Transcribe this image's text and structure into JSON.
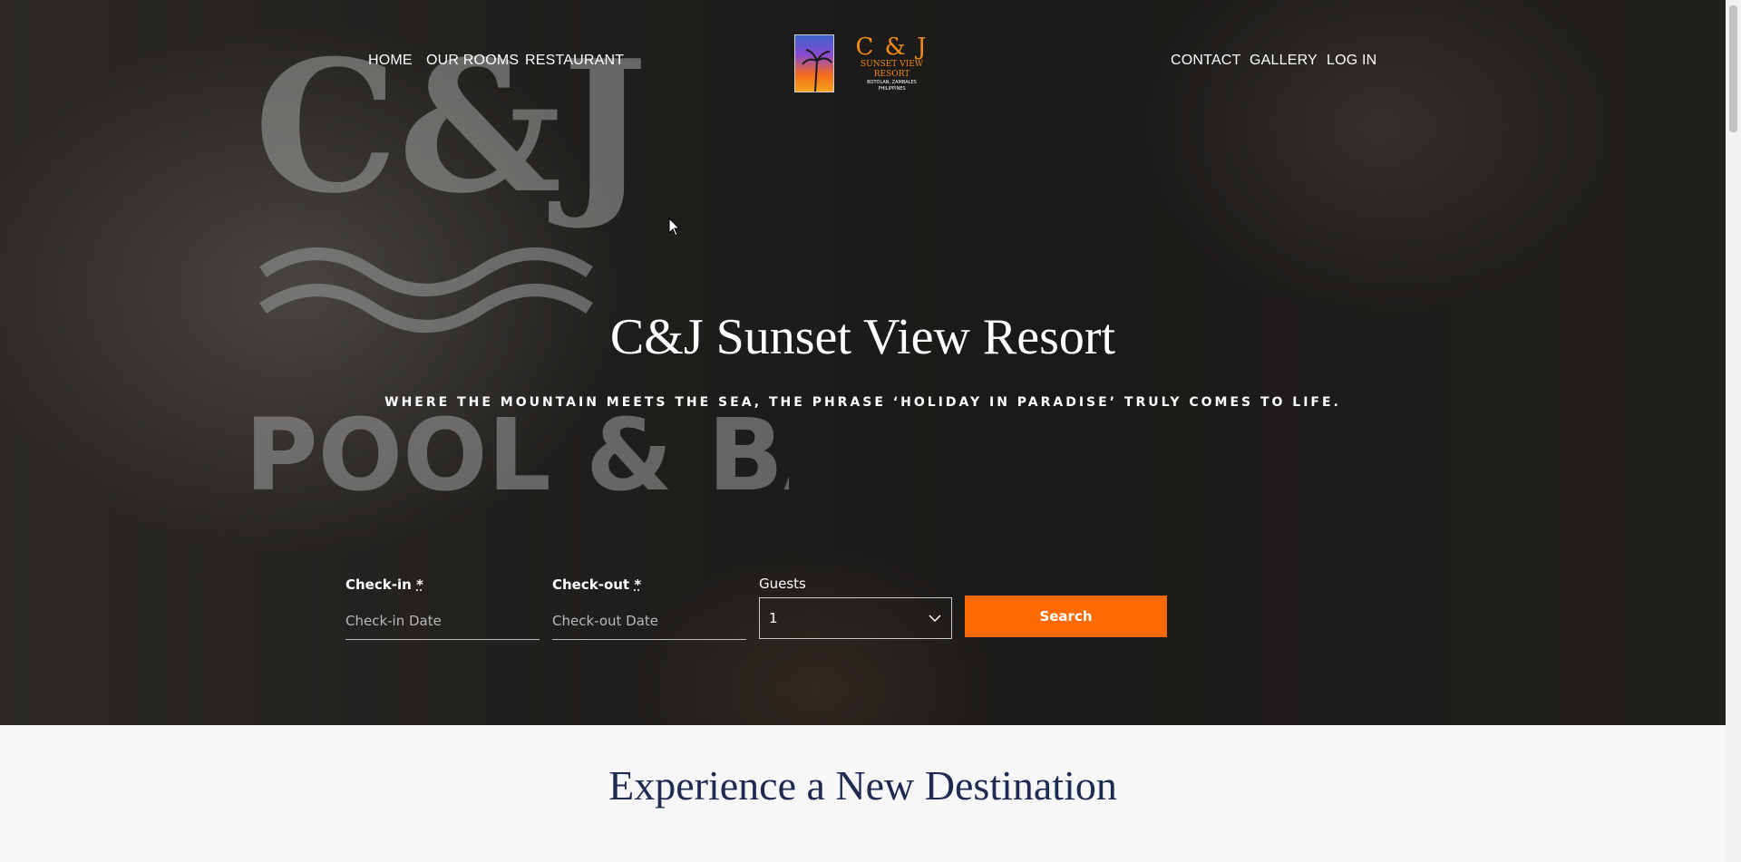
{
  "nav": {
    "left": [
      "HOME",
      "OUR ROOMS",
      "RESTAURANT"
    ],
    "right": [
      "CONTACT",
      "GALLERY",
      "LOG IN"
    ]
  },
  "logo": {
    "mark": "C & J",
    "name": "SUNSET VIEW RESORT",
    "sub_line1": "BOTOLAN, ZAMBALES",
    "sub_line2": "PHILIPPINES"
  },
  "hero": {
    "sign_text_1": "C&J",
    "sign_text_2": "POOL & BAR",
    "title": "C&J Sunset View Resort",
    "tagline": "WHERE THE MOUNTAIN MEETS THE SEA, THE PHRASE ‘HOLIDAY IN PARADISE’ TRULY COMES TO LIFE."
  },
  "booking": {
    "checkin_label": "Check-in",
    "checkin_placeholder": "Check-in Date",
    "checkout_label": "Check-out",
    "checkout_placeholder": "Check-out Date",
    "required_mark": "*",
    "guests_label": "Guests",
    "guests_value": "1",
    "search_label": "Search"
  },
  "section": {
    "title": "Experience a New Destination"
  },
  "colors": {
    "accent": "#ff6a00",
    "heading": "#1f2a52",
    "logo_orange": "#f08a1a"
  }
}
